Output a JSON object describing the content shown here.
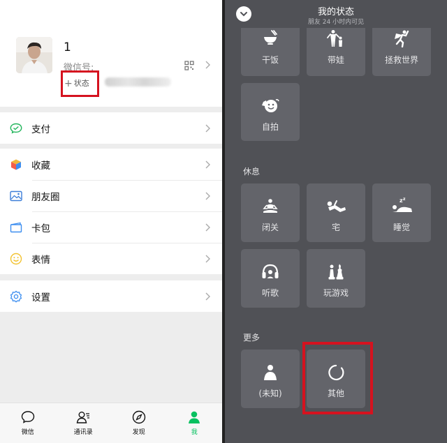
{
  "left": {
    "profile": {
      "nickname": "1",
      "wxid_label": "微信号:",
      "status_button_plus": "+",
      "status_button_label": "状态"
    },
    "menu": [
      {
        "label": "支付",
        "icon": "pay-icon"
      },
      {
        "label": "收藏",
        "icon": "favorites-icon"
      },
      {
        "label": "朋友圈",
        "icon": "moments-icon"
      },
      {
        "label": "卡包",
        "icon": "card-wallet-icon"
      },
      {
        "label": "表情",
        "icon": "sticker-icon"
      },
      {
        "label": "设置",
        "icon": "settings-icon"
      }
    ],
    "tabs": [
      {
        "label": "微信",
        "icon": "chat-icon"
      },
      {
        "label": "通讯录",
        "icon": "contacts-icon"
      },
      {
        "label": "发现",
        "icon": "discover-icon"
      },
      {
        "label": "我",
        "icon": "me-icon",
        "active": true
      }
    ]
  },
  "right": {
    "title": "我的状态",
    "subtitle": "朋友 24 小时内可见",
    "tiles_top": [
      {
        "label": "干饭",
        "icon": "rice-bowl-icon"
      },
      {
        "label": "带娃",
        "icon": "parent-child-icon"
      },
      {
        "label": "拯救世界",
        "icon": "superhero-icon"
      },
      {
        "label": "自拍",
        "icon": "selfie-icon"
      }
    ],
    "section_rest": "休息",
    "tiles_rest": [
      {
        "label": "闭关",
        "icon": "meditate-icon"
      },
      {
        "label": "宅",
        "icon": "lounging-icon"
      },
      {
        "label": "睡觉",
        "icon": "sleep-icon"
      },
      {
        "label": "听歌",
        "icon": "headphones-icon"
      },
      {
        "label": "玩游戏",
        "icon": "game-pieces-icon"
      }
    ],
    "section_more": "更多",
    "tiles_more": [
      {
        "label": "(未知)",
        "icon": "person-icon"
      },
      {
        "label": "其他",
        "icon": "loading-circle-icon"
      }
    ]
  },
  "colors": {
    "accent_green": "#07c160",
    "highlight_red": "#d5121f",
    "panel_dark": "#505156",
    "tile": "#63646a"
  }
}
